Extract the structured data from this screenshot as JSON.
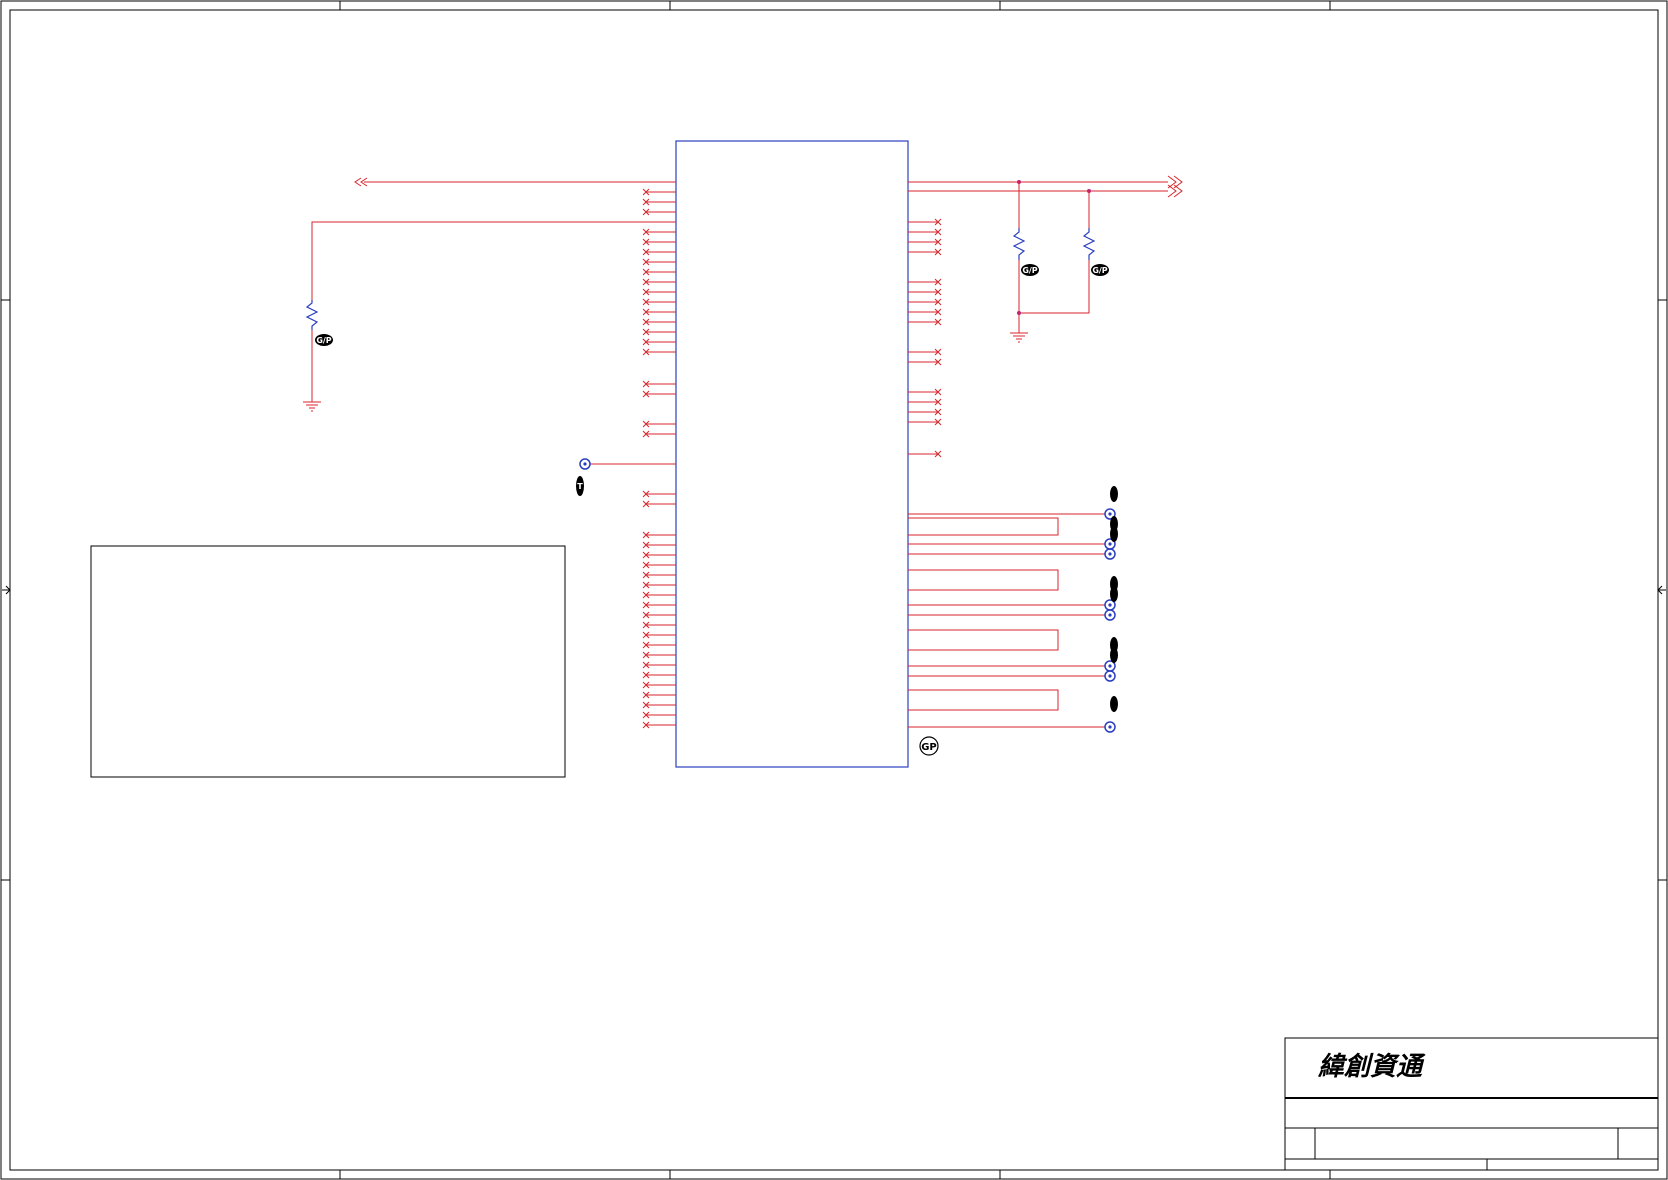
{
  "sheet": {
    "company_logo_text": "緯創資通",
    "testpoint_mark": "GP",
    "resistor_mark": "G/P",
    "tp_mark": "T",
    "colors": {
      "frame": "#000000",
      "wire": "#d8262c",
      "component": "#2a3fbf",
      "junction": "#c0247a"
    }
  }
}
